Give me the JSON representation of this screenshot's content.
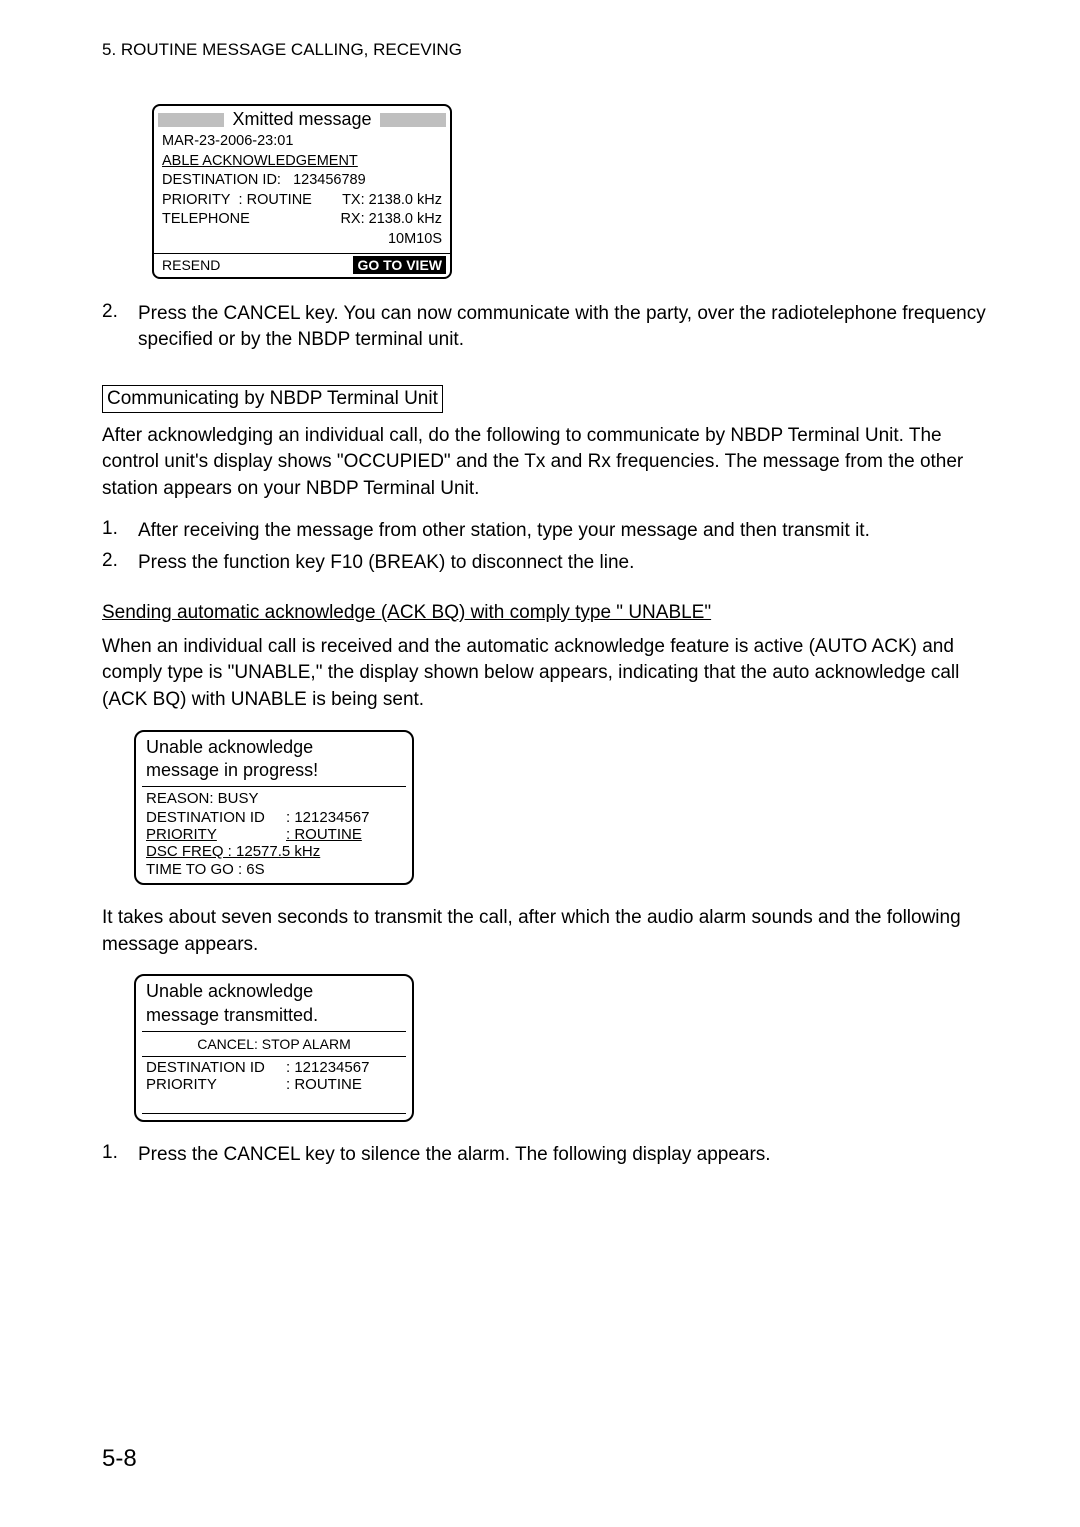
{
  "header": "5. ROUTINE MESSAGE CALLING, RECEVING",
  "display1": {
    "title": "Xmitted message",
    "timestamp": "MAR-23-2006-23:01",
    "ack": "ABLE ACKNOWLEDGEMENT",
    "dest_label": "DESTINATION ID:",
    "dest_val": "123456789",
    "priority_label": "PRIORITY",
    "priority_val": ": ROUTINE",
    "tx": "TX: 2138.0 kHz",
    "telephone": "TELEPHONE",
    "rx": "RX: 2138.0 kHz",
    "timer": "10M10S",
    "resend": "RESEND",
    "goto": "GO TO VIEW"
  },
  "item2": "Press the CANCEL key. You can now communicate with the party, over the radiotelephone frequency specified or by the NBDP terminal unit.",
  "nbdp_heading": "Communicating by NBDP Terminal Unit",
  "nbdp_para": "After acknowledging an individual call, do the following to communicate by NBDP Terminal Unit. The control unit's display shows \"OCCUPIED\" and the Tx and Rx frequencies. The message from the other station appears on your NBDP Terminal Unit.",
  "nbdp_step1": "After receiving the message from other station, type your message and then transmit it.",
  "nbdp_step2": "Press the function key F10 (BREAK) to disconnect the line.",
  "unable_heading": "Sending automatic acknowledge (ACK BQ) with comply type \" UNABLE\"",
  "unable_para": "When an individual call is received and the automatic acknowledge feature is active (AUTO ACK) and comply type is \"UNABLE,\" the display shown below appears, indicating that the auto acknowledge call (ACK BQ) with UNABLE is being sent.",
  "display2": {
    "line1": "Unable acknowledge",
    "line2": "message in progress!",
    "reason": "REASON: BUSY",
    "dest_label": "DESTINATION ID",
    "dest_val": ": 121234567",
    "priority_label": "PRIORITY",
    "priority_val": ": ROUTINE",
    "dsc": "DSC FREQ  : 12577.5 kHz",
    "time": "TIME TO GO : 6S"
  },
  "after_para": "It takes about seven seconds to transmit the call, after which the audio alarm sounds and the following message appears.",
  "display3": {
    "line1": "Unable acknowledge",
    "line2": "message transmitted.",
    "cancel": "CANCEL: STOP ALARM",
    "dest_label": "DESTINATION ID",
    "dest_val": ": 121234567",
    "priority_label": "PRIORITY",
    "priority_val": ":  ROUTINE"
  },
  "final_step": "Press the CANCEL key to silence the alarm. The following display appears.",
  "page_num": "5-8"
}
